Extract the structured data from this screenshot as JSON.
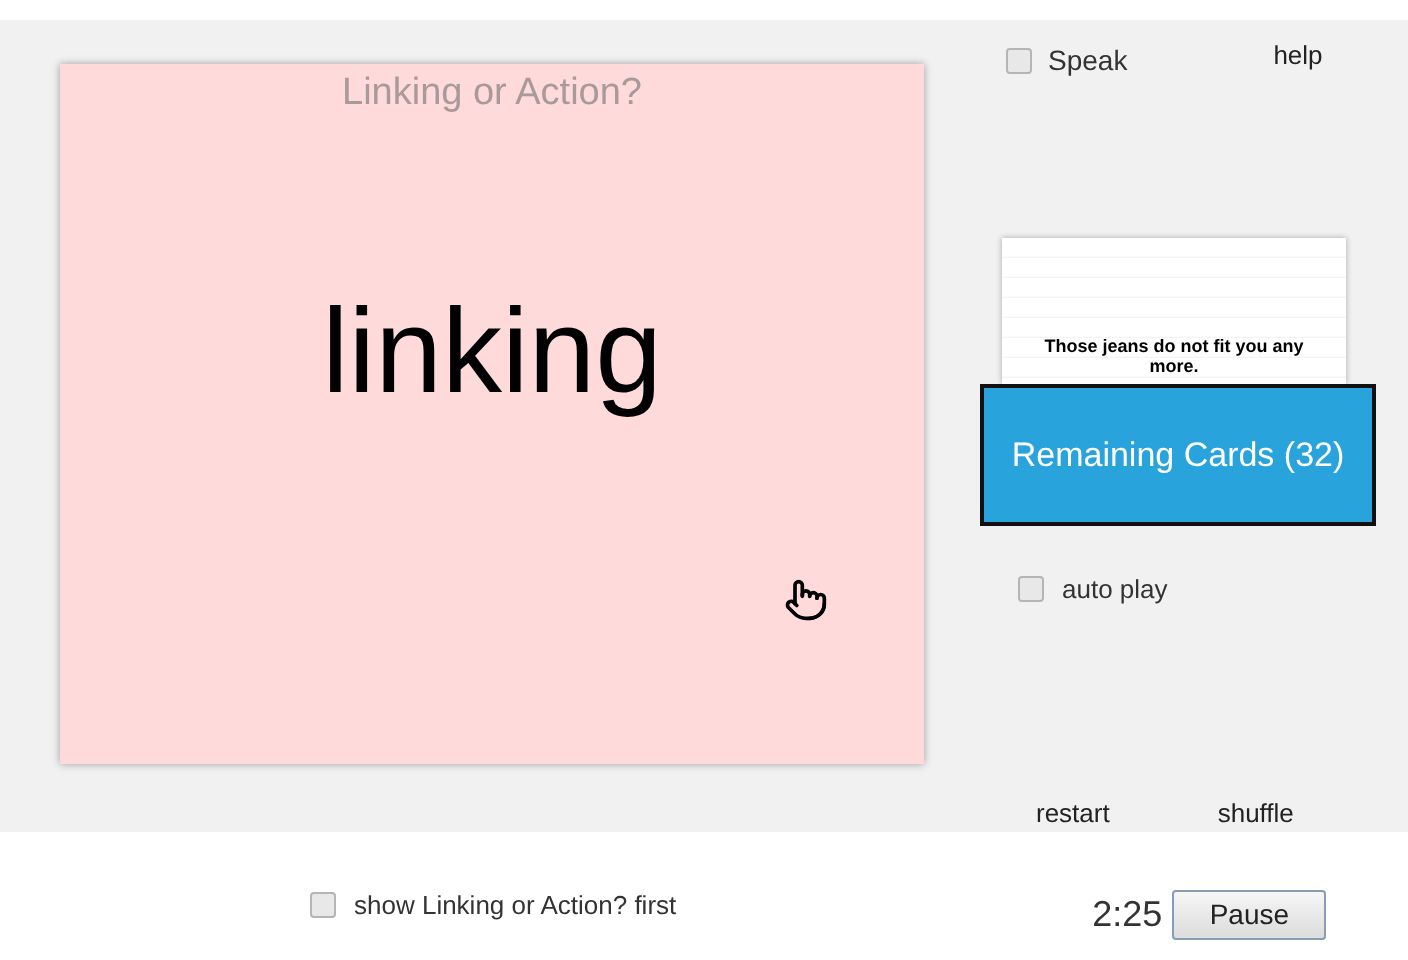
{
  "card": {
    "title": "Linking or Action?",
    "answer": "linking"
  },
  "speak": {
    "label": "Speak",
    "checked": false
  },
  "help": "help",
  "preview_card": {
    "sentence": "Those jeans do not fit you any more."
  },
  "remaining_button": "Remaining Cards (32)",
  "auto_play": {
    "label": "auto play",
    "checked": false
  },
  "restart": "restart",
  "shuffle": "shuffle",
  "show_first": {
    "label": "show Linking or Action? first",
    "checked": false
  },
  "timer": "2:25",
  "pause_button": "Pause"
}
